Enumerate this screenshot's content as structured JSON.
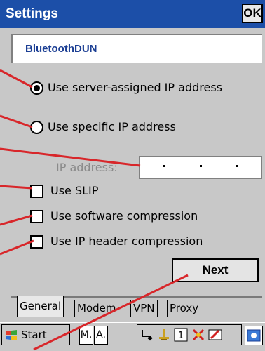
{
  "titlebar": {
    "title": "Settings",
    "ok_label": "OK"
  },
  "connection": {
    "name": "BluetoothDUN"
  },
  "options": {
    "server_ip_label": "Use server-assigned IP address",
    "specific_ip_label": "Use specific IP address",
    "ip_address_label": "IP address:",
    "ip_address_value": ". . .",
    "use_slip_label": "Use SLIP",
    "software_compression_label": "Use software compression",
    "ip_header_compression_label": "Use IP header compression"
  },
  "next_label": "Next",
  "tabs": [
    {
      "label": "General",
      "active": true
    },
    {
      "label": "Modem",
      "active": false
    },
    {
      "label": "VPN",
      "active": false
    },
    {
      "label": "Proxy",
      "active": false
    }
  ],
  "taskbar": {
    "start_label": "Start",
    "input_m": "M.",
    "input_a": "A."
  },
  "colors": {
    "titlebar": "#1c4fa8",
    "accent_text": "#1c3f94",
    "callout": "#d8262a",
    "background": "#c8c8c8"
  },
  "icons": [
    "windows-flag-icon",
    "network-icon",
    "usb-icon",
    "number-1-icon",
    "disconnect-icon",
    "pen-icon",
    "keyboard-icon"
  ]
}
